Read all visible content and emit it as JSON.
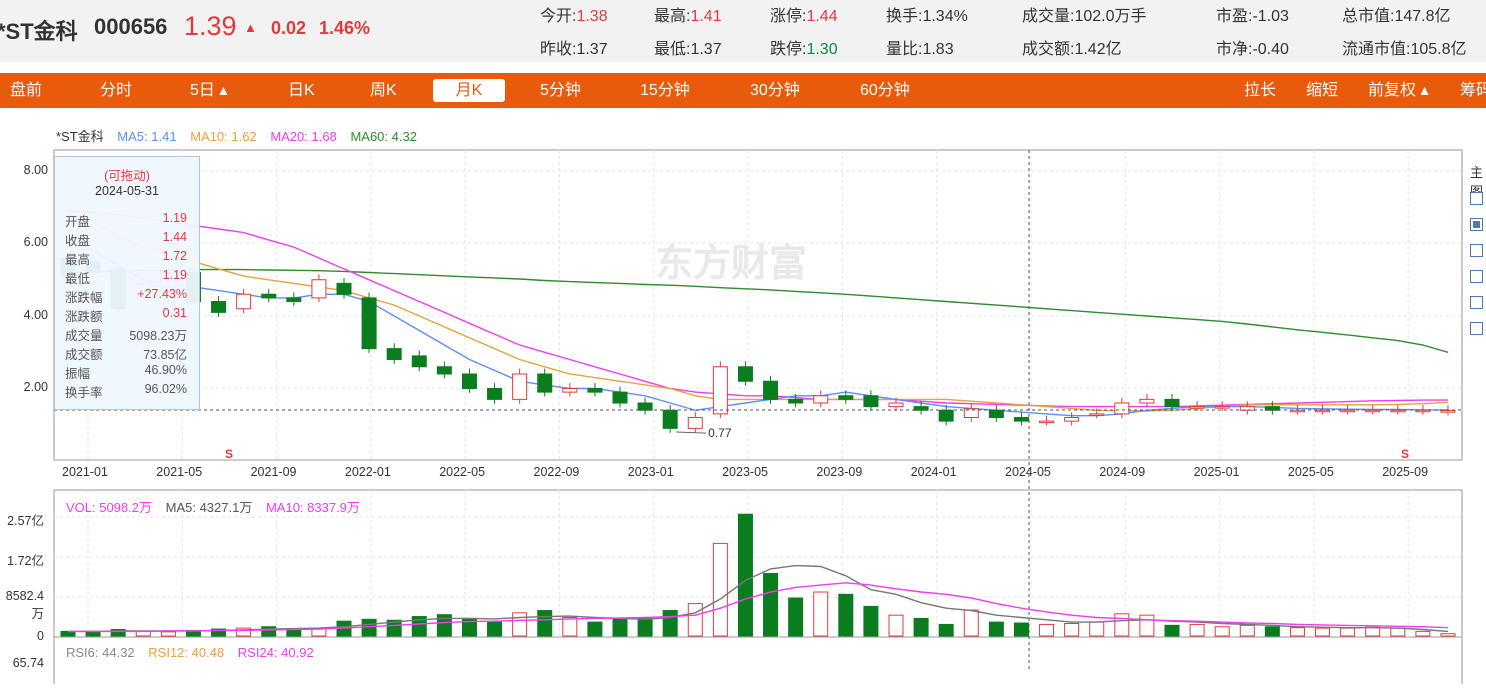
{
  "header": {
    "name": "*ST金科",
    "code": "000656",
    "price": "1.39",
    "arrow": "▲",
    "change": "0.02",
    "change_pct": "1.46%",
    "quotes": [
      {
        "label": "今开:",
        "value": "1.38",
        "color": "red"
      },
      {
        "label": "最高:",
        "value": "1.41",
        "color": "red"
      },
      {
        "label": "涨停:",
        "value": "1.44",
        "color": "red"
      },
      {
        "label": "换手:",
        "value": "1.34%",
        "color": ""
      },
      {
        "label": "成交量:",
        "value": "102.0万手",
        "color": ""
      },
      {
        "label": "市盈:",
        "value": "-1.03",
        "color": ""
      },
      {
        "label": "总市值:",
        "value": "147.8亿",
        "color": ""
      },
      {
        "label": "昨收:",
        "value": "1.37",
        "color": ""
      },
      {
        "label": "最低:",
        "value": "1.37",
        "color": ""
      },
      {
        "label": "跌停:",
        "value": "1.30",
        "color": "green"
      },
      {
        "label": "量比:",
        "value": "1.83",
        "color": ""
      },
      {
        "label": "成交额:",
        "value": "1.42亿",
        "color": ""
      },
      {
        "label": "市净:",
        "value": "-0.40",
        "color": ""
      },
      {
        "label": "流通市值:",
        "value": "105.8亿",
        "color": ""
      }
    ]
  },
  "tabs": [
    "盘前",
    "分时",
    "5日 ▴",
    "日K",
    "周K",
    "月K",
    "5分钟",
    "15分钟",
    "30分钟",
    "60分钟",
    "拉长",
    "缩短",
    "前复权 ▴",
    "筹码"
  ],
  "active_tab": "月K",
  "main_legend": {
    "name": "*ST金科",
    "ma5": "MA5: 1.41",
    "ma10": "MA10: 1.62",
    "ma20": "MA20: 1.68",
    "ma60": "MA60: 4.32"
  },
  "colors": {
    "up": "#e4393c",
    "down": "#0a7d1f",
    "ma5": "#5b8ff9",
    "ma10": "#e6a23c",
    "ma20": "#f03cf0",
    "ma60": "#2e8b2e",
    "accent": "#e85a0c"
  },
  "watermark": "东方财富",
  "tooltip": {
    "title": "(可拖动)",
    "date": "2024-05-31",
    "rows": [
      {
        "k": "开盘",
        "v": "1.19"
      },
      {
        "k": "收盘",
        "v": "1.44"
      },
      {
        "k": "最高",
        "v": "1.72"
      },
      {
        "k": "最低",
        "v": "1.19"
      },
      {
        "k": "涨跌幅",
        "v": "+27.43%"
      },
      {
        "k": "涨跌额",
        "v": "0.31"
      },
      {
        "k": "成交量",
        "v": "5098.23万"
      },
      {
        "k": "成交额",
        "v": "73.85亿"
      },
      {
        "k": "振幅",
        "v": "46.90%"
      },
      {
        "k": "换手率",
        "v": "96.02%"
      }
    ]
  },
  "price_axis": [
    "8.00",
    "6.00",
    "4.00",
    "2.00"
  ],
  "date_axis": [
    "2021-01",
    "2021-05",
    "2021-09",
    "2022-01",
    "2022-05",
    "2022-09",
    "2023-01",
    "2023-05",
    "2023-09",
    "2024-01",
    "2024-05",
    "2024-09",
    "2025-01",
    "2025-05",
    "2025-09"
  ],
  "min_label": "0.77",
  "markers": [
    "S",
    "S"
  ],
  "vol_legend": {
    "vol": "VOL: 5098.2万",
    "ma5": "MA5: 4327.1万",
    "ma10": "MA10: 8337.9万"
  },
  "vol_axis": [
    "2.57亿",
    "1.72亿",
    "8582.4万",
    "0"
  ],
  "rsi_legend": {
    "rsi6": "RSI6: 44.32",
    "rsi12": "RSI12: 40.48",
    "rsi24": "RSI24: 40.92"
  },
  "rsi_axis_top": "65.74",
  "side_label": "主图",
  "chart_data": {
    "type": "candlestick",
    "period": "monthly",
    "ylim": [
      0.5,
      8.5
    ],
    "candles": [
      {
        "o": 5.6,
        "c": 5.1
      },
      {
        "o": 5.5,
        "c": 5.2
      },
      {
        "o": 5.3,
        "c": 4.2
      },
      {
        "o": 4.5,
        "c": 4.9
      },
      {
        "o": 4.8,
        "c": 5.2
      },
      {
        "o": 5.2,
        "c": 4.4
      },
      {
        "o": 4.4,
        "c": 4.1
      },
      {
        "o": 4.2,
        "c": 4.6
      },
      {
        "o": 4.6,
        "c": 4.5
      },
      {
        "o": 4.5,
        "c": 4.4
      },
      {
        "o": 4.5,
        "c": 5.0
      },
      {
        "o": 4.9,
        "c": 4.6
      },
      {
        "o": 4.5,
        "c": 3.1
      },
      {
        "o": 3.1,
        "c": 2.8
      },
      {
        "o": 2.9,
        "c": 2.6
      },
      {
        "o": 2.6,
        "c": 2.4
      },
      {
        "o": 2.4,
        "c": 2.0
      },
      {
        "o": 2.0,
        "c": 1.7
      },
      {
        "o": 1.7,
        "c": 2.4
      },
      {
        "o": 2.4,
        "c": 1.9
      },
      {
        "o": 1.9,
        "c": 2.0
      },
      {
        "o": 2.0,
        "c": 1.9
      },
      {
        "o": 1.9,
        "c": 1.6
      },
      {
        "o": 1.6,
        "c": 1.4
      },
      {
        "o": 1.4,
        "c": 0.9
      },
      {
        "o": 0.9,
        "c": 1.2
      },
      {
        "o": 1.3,
        "c": 2.6
      },
      {
        "o": 2.6,
        "c": 2.2
      },
      {
        "o": 2.2,
        "c": 1.7
      },
      {
        "o": 1.7,
        "c": 1.6
      },
      {
        "o": 1.6,
        "c": 1.8
      },
      {
        "o": 1.8,
        "c": 1.7
      },
      {
        "o": 1.8,
        "c": 1.5
      },
      {
        "o": 1.5,
        "c": 1.6
      },
      {
        "o": 1.5,
        "c": 1.4
      },
      {
        "o": 1.4,
        "c": 1.1
      },
      {
        "o": 1.2,
        "c": 1.44
      },
      {
        "o": 1.4,
        "c": 1.2
      },
      {
        "o": 1.2,
        "c": 1.1
      },
      {
        "o": 1.1,
        "c": 1.1
      },
      {
        "o": 1.1,
        "c": 1.2
      },
      {
        "o": 1.3,
        "c": 1.3
      },
      {
        "o": 1.3,
        "c": 1.6
      },
      {
        "o": 1.6,
        "c": 1.7
      },
      {
        "o": 1.7,
        "c": 1.5
      },
      {
        "o": 1.5,
        "c": 1.5
      },
      {
        "o": 1.5,
        "c": 1.5
      },
      {
        "o": 1.4,
        "c": 1.5
      },
      {
        "o": 1.5,
        "c": 1.4
      },
      {
        "o": 1.4,
        "c": 1.4
      },
      {
        "o": 1.4,
        "c": 1.4
      },
      {
        "o": 1.4,
        "c": 1.4
      },
      {
        "o": 1.4,
        "c": 1.4
      },
      {
        "o": 1.4,
        "c": 1.4
      },
      {
        "o": 1.4,
        "c": 1.4
      },
      {
        "o": 1.38,
        "c": 1.39
      }
    ],
    "ma5": [
      6.1,
      5.8,
      5.4,
      5.0,
      4.9,
      4.8,
      4.7,
      4.6,
      4.5,
      4.5,
      4.6,
      4.6,
      4.4,
      4.0,
      3.6,
      3.2,
      2.8,
      2.5,
      2.2,
      2.1,
      2.0,
      2.0,
      1.9,
      1.8,
      1.6,
      1.4,
      1.5,
      1.6,
      1.7,
      1.8,
      1.8,
      1.9,
      1.8,
      1.7,
      1.6,
      1.5,
      1.45,
      1.4,
      1.35,
      1.3,
      1.25,
      1.25,
      1.3,
      1.4,
      1.45,
      1.5,
      1.5,
      1.5,
      1.48,
      1.45,
      1.44,
      1.43,
      1.42,
      1.42,
      1.41,
      1.41
    ],
    "ma10": [
      6.8,
      6.6,
      6.2,
      5.9,
      5.7,
      5.5,
      5.3,
      5.1,
      5.0,
      4.9,
      4.8,
      4.7,
      4.5,
      4.3,
      4.0,
      3.7,
      3.4,
      3.1,
      2.8,
      2.6,
      2.4,
      2.3,
      2.2,
      2.1,
      2.0,
      1.8,
      1.7,
      1.7,
      1.7,
      1.7,
      1.7,
      1.7,
      1.7,
      1.7,
      1.7,
      1.7,
      1.65,
      1.6,
      1.55,
      1.5,
      1.45,
      1.4,
      1.38,
      1.38,
      1.4,
      1.45,
      1.5,
      1.55,
      1.55,
      1.55,
      1.55,
      1.55,
      1.55,
      1.56,
      1.58,
      1.62
    ],
    "ma20": [
      6.9,
      6.85,
      6.8,
      6.7,
      6.6,
      6.5,
      6.4,
      6.3,
      6.1,
      5.9,
      5.6,
      5.3,
      5.0,
      4.7,
      4.4,
      4.1,
      3.8,
      3.5,
      3.2,
      3.0,
      2.8,
      2.6,
      2.4,
      2.2,
      2.0,
      1.9,
      1.85,
      1.8,
      1.8,
      1.75,
      1.7,
      1.7,
      1.7,
      1.7,
      1.65,
      1.6,
      1.58,
      1.56,
      1.54,
      1.52,
      1.5,
      1.5,
      1.5,
      1.5,
      1.5,
      1.52,
      1.54,
      1.56,
      1.58,
      1.6,
      1.62,
      1.64,
      1.66,
      1.67,
      1.68,
      1.68
    ],
    "ma60": [
      5.2,
      5.22,
      5.24,
      5.26,
      5.27,
      5.28,
      5.28,
      5.28,
      5.27,
      5.26,
      5.25,
      5.23,
      5.2,
      5.17,
      5.14,
      5.11,
      5.08,
      5.05,
      5.02,
      4.98,
      4.95,
      4.92,
      4.9,
      4.87,
      4.85,
      4.82,
      4.78,
      4.75,
      4.72,
      4.68,
      4.64,
      4.6,
      4.55,
      4.5,
      4.45,
      4.4,
      4.35,
      4.3,
      4.25,
      4.2,
      4.15,
      4.1,
      4.05,
      4.0,
      3.95,
      3.9,
      3.85,
      3.78,
      3.7,
      3.62,
      3.55,
      3.48,
      3.4,
      3.32,
      3.2,
      3.0
    ],
    "volume": [
      0.1,
      0.1,
      0.14,
      0.1,
      0.09,
      0.12,
      0.15,
      0.17,
      0.2,
      0.16,
      0.15,
      0.32,
      0.36,
      0.34,
      0.42,
      0.46,
      0.38,
      0.3,
      0.5,
      0.55,
      0.4,
      0.3,
      0.36,
      0.38,
      0.55,
      0.7,
      2.0,
      2.63,
      1.35,
      0.82,
      0.95,
      0.9,
      0.64,
      0.45,
      0.38,
      0.25,
      0.56,
      0.3,
      0.28,
      0.25,
      0.27,
      0.3,
      0.48,
      0.45,
      0.23,
      0.25,
      0.2,
      0.23,
      0.2,
      0.18,
      0.17,
      0.17,
      0.19,
      0.17,
      0.1,
      0.05
    ],
    "vol_ma5": [
      0.1,
      0.1,
      0.11,
      0.11,
      0.11,
      0.11,
      0.12,
      0.13,
      0.15,
      0.16,
      0.17,
      0.2,
      0.25,
      0.3,
      0.35,
      0.38,
      0.38,
      0.37,
      0.4,
      0.42,
      0.43,
      0.4,
      0.38,
      0.36,
      0.4,
      0.5,
      0.8,
      1.2,
      1.45,
      1.52,
      1.5,
      1.3,
      1.0,
      0.9,
      0.72,
      0.6,
      0.55,
      0.45,
      0.4,
      0.35,
      0.3,
      0.3,
      0.33,
      0.35,
      0.32,
      0.3,
      0.27,
      0.25,
      0.23,
      0.2,
      0.19,
      0.18,
      0.18,
      0.17,
      0.14,
      0.1
    ],
    "vol_ma10": [
      0.1,
      0.1,
      0.1,
      0.1,
      0.11,
      0.11,
      0.12,
      0.12,
      0.13,
      0.14,
      0.15,
      0.17,
      0.2,
      0.23,
      0.26,
      0.29,
      0.31,
      0.32,
      0.34,
      0.35,
      0.37,
      0.38,
      0.39,
      0.4,
      0.42,
      0.45,
      0.6,
      0.8,
      0.95,
      1.05,
      1.1,
      1.15,
      1.1,
      1.02,
      0.95,
      0.9,
      0.82,
      0.7,
      0.6,
      0.52,
      0.45,
      0.4,
      0.38,
      0.35,
      0.33,
      0.32,
      0.3,
      0.28,
      0.27,
      0.25,
      0.24,
      0.23,
      0.22,
      0.21,
      0.2,
      0.18
    ]
  }
}
